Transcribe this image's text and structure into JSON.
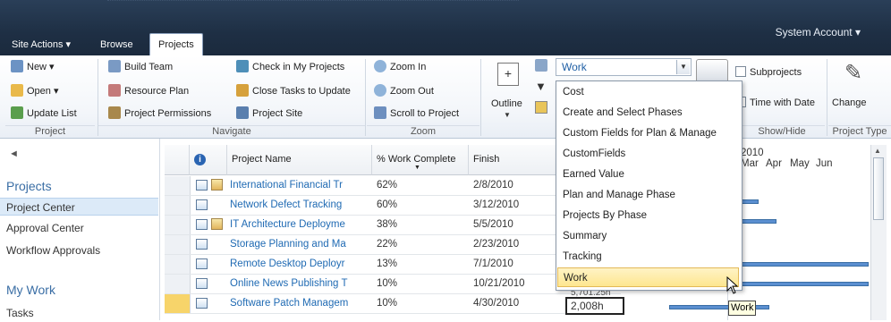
{
  "topbar": {
    "tabs": [
      "Site Actions ▾",
      "Browse",
      "Projects"
    ],
    "account": "System Account ▾"
  },
  "ribbon": {
    "project": {
      "new": "New ▾",
      "open": "Open ▾",
      "update": "Update List",
      "group": "Project"
    },
    "navigate": {
      "build_team": "Build Team",
      "resource_plan": "Resource Plan",
      "permissions": "Project Permissions",
      "check_in": "Check in My Projects",
      "close_tasks": "Close Tasks to Update",
      "project_site": "Project Site",
      "group": "Navigate"
    },
    "zoom": {
      "zoom_in": "Zoom In",
      "zoom_out": "Zoom Out",
      "scroll": "Scroll to Project",
      "group": "Zoom"
    },
    "outline": "Outline",
    "view_combo": "Work",
    "show_hide": {
      "subprojects": "Subprojects",
      "time_with_date": "Time with Date",
      "group": "Show/Hide"
    },
    "change": "Change",
    "project_type": "Project Type"
  },
  "dropdown": {
    "items": [
      "Cost",
      "Create and Select Phases",
      "Custom Fields for Plan & Manage",
      "CustomFields",
      "Earned Value",
      "Plan and Manage Phase",
      "Projects By Phase",
      "Summary",
      "Tracking",
      "Work"
    ],
    "highlighted": "Work"
  },
  "leftnav": {
    "collapse": "◄",
    "projects_heading": "Projects",
    "items": [
      "Project Center",
      "Approval Center",
      "Workflow Approvals"
    ],
    "mywork_heading": "My Work",
    "tasks": "Tasks"
  },
  "grid": {
    "headers": {
      "info": "i",
      "name": "Project Name",
      "pct": "% Work Complete",
      "finish": "Finish"
    },
    "rows": [
      {
        "name": "International Financial Tr",
        "pct": "62%",
        "finish": "2/8/2010"
      },
      {
        "name": "Network Defect Tracking",
        "pct": "60%",
        "finish": "3/12/2010"
      },
      {
        "name": "IT Architecture Deployme",
        "pct": "38%",
        "finish": "5/5/2010"
      },
      {
        "name": "Storage Planning and Ma",
        "pct": "22%",
        "finish": "2/23/2010"
      },
      {
        "name": "Remote Desktop Deployr",
        "pct": "13%",
        "finish": "7/1/2010"
      },
      {
        "name": "Online News Publishing T",
        "pct": "10%",
        "finish": "10/21/2010"
      },
      {
        "name": "Software Patch Managem",
        "pct": "10%",
        "finish": "4/30/2010"
      }
    ],
    "edit_value": "2,008h",
    "partial_value": "5,701.25h"
  },
  "gantt": {
    "year": "2010",
    "months": [
      "Mar",
      "Apr",
      "May",
      "Jun"
    ]
  },
  "tooltip": "Work"
}
